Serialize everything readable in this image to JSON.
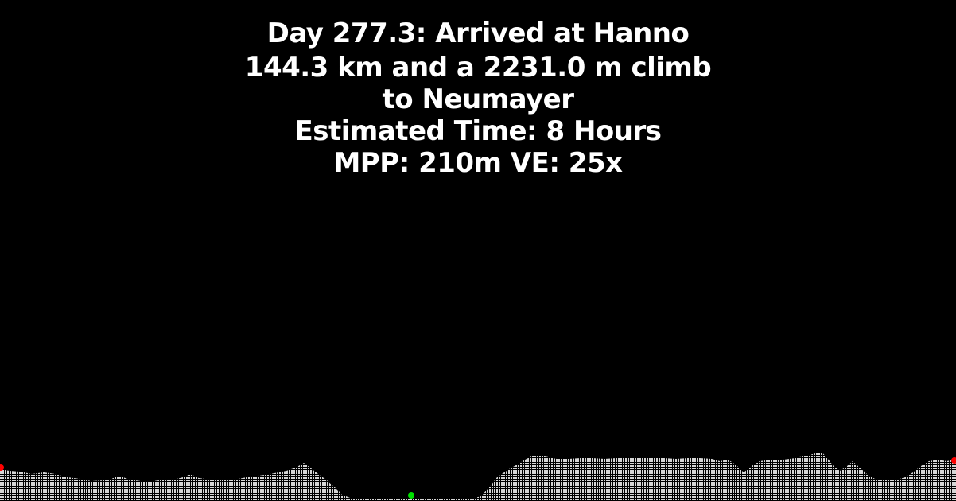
{
  "header": {
    "status_line": "Day 277.3: Arrived at Hanno",
    "route_line": "144.3 km and a 2231.0 m climb",
    "destination_line": "to Neumayer",
    "time_line": "Estimated Time: 8 Hours",
    "scale_line": "MPP: 210m VE: 25x"
  },
  "colors": {
    "background": "#000000",
    "text": "#ffffff",
    "terrain": "#cfcfcf",
    "endpoint_marker": "#ff0000",
    "position_marker": "#00e000"
  },
  "markers": {
    "current_position_fraction": 0.43
  }
}
